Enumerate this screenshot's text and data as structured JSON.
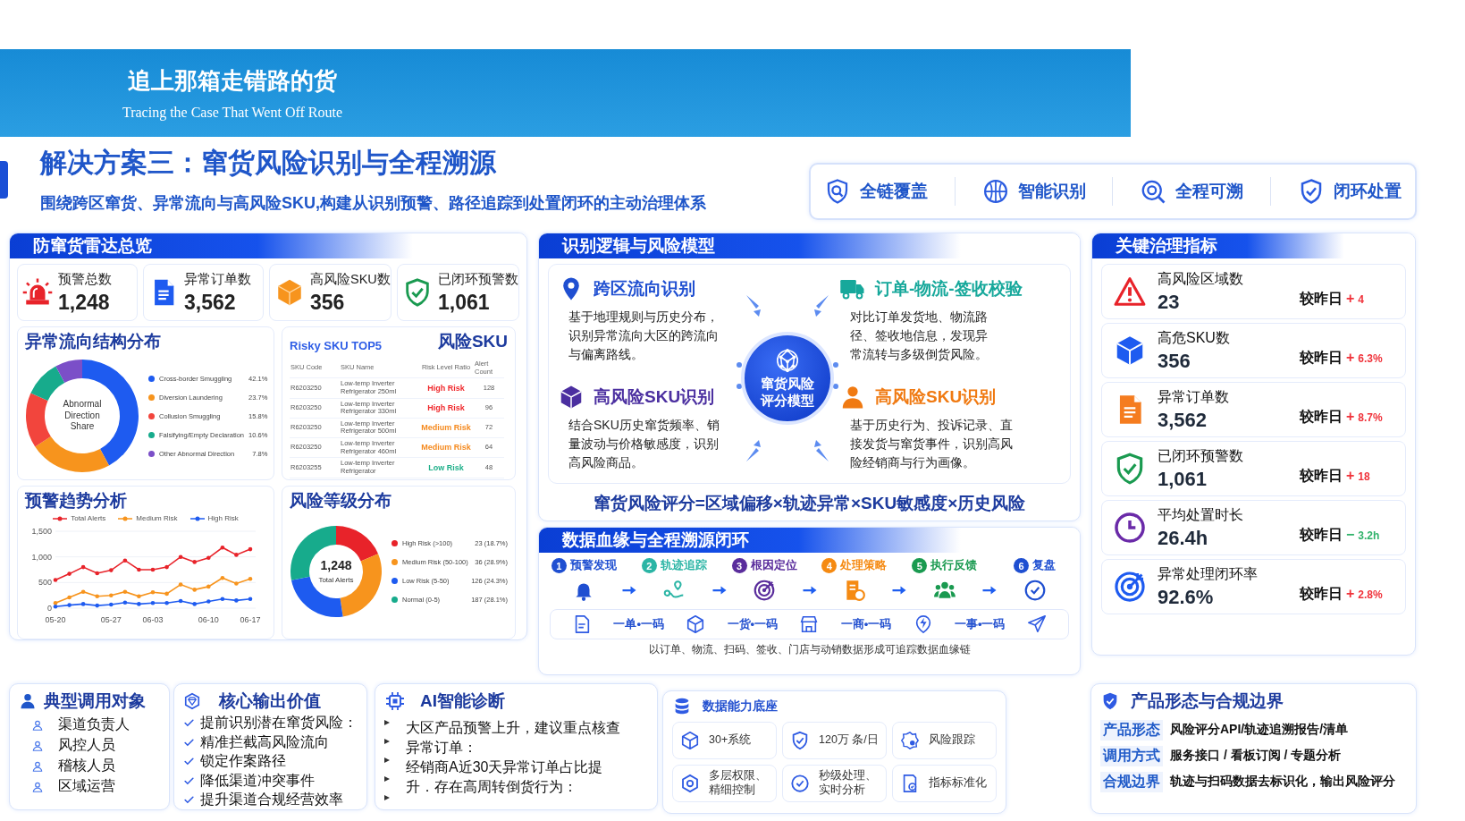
{
  "banner": {
    "title": "追上那箱走错路的货",
    "subtitle": "Tracing the Case That Went Off Route"
  },
  "heading": {
    "title": "解决方案三：窜货风险识别与全程溯源",
    "subtitle": "围绕跨区窜货、异常流向与高风险SKU,构建从识别预警、路径追踪到处置闭环的主动治理体系",
    "highlights": [
      "全链覆盖",
      "智能识别",
      "全程可溯",
      "闭环处置"
    ]
  },
  "radar": {
    "title": "防窜货雷达总览",
    "stats": [
      {
        "label": "预警总数",
        "value": "1,248"
      },
      {
        "label": "异常订单数",
        "value": "3,562"
      },
      {
        "label": "高风险SKU数",
        "value": "356"
      },
      {
        "label": "已闭环预警数",
        "value": "1,061"
      }
    ],
    "flow": {
      "title": "异常流向结构分布",
      "chart_data": {
        "type": "donut",
        "title": "Abnormal Direction Share",
        "categories": [
          "Cross-border Smuggling",
          "Diversion Laundering",
          "Collusion Smuggling",
          "Falsifying/Empty Declaration",
          "Other Abnormal Direction"
        ],
        "values": [
          42.1,
          23.7,
          15.8,
          10.6,
          7.8
        ],
        "colors": [
          "#1e5bf0",
          "#f7941d",
          "#f2453d",
          "#17ab8c",
          "#7b4fc8"
        ],
        "value_labels": [
          "42.1%",
          "23.7%",
          "15.8%",
          "10.6%",
          "7.8%"
        ]
      }
    },
    "sku": {
      "title": "风险SKU",
      "caption": "Risky SKU TOP5",
      "columns": [
        "SKU Code",
        "SKU Name",
        "Risk Level Ratio",
        "Alert Count"
      ],
      "rows": [
        {
          "code": "R6203250",
          "name": "Low-temp Inverter Refrigerator 250ml",
          "risk": "High Risk",
          "color": "#f0292c",
          "count": "128"
        },
        {
          "code": "R6203250",
          "name": "Low-temp Inverter Refrigerator 330ml",
          "risk": "High Risk",
          "color": "#f0292c",
          "count": "96"
        },
        {
          "code": "R6203250",
          "name": "Low-temp Inverter Refrigerator 500ml",
          "risk": "Medium Risk",
          "color": "#f58a1f",
          "count": "72"
        },
        {
          "code": "R6203250",
          "name": "Low-temp Inverter Refrigerator 460ml",
          "risk": "Medium Risk",
          "color": "#f58a1f",
          "count": "64"
        },
        {
          "code": "R6203255",
          "name": "Low-temp Inverter Refrigerator",
          "risk": "Low Risk",
          "color": "#20b08a",
          "count": "48"
        }
      ]
    },
    "trend": {
      "title": "预警趋势分析",
      "chart_data": {
        "type": "line",
        "categories": [
          "05-20",
          null,
          null,
          null,
          "05-27",
          null,
          null,
          "06-03",
          null,
          null,
          null,
          "06-10",
          null,
          null,
          "06-17"
        ],
        "ylim": [
          0,
          1500
        ],
        "yticks": [
          {
            "value": 0,
            "label": "0"
          },
          {
            "value": 500,
            "label": "500"
          },
          {
            "value": 1000,
            "label": "1,000"
          },
          {
            "value": 1500,
            "label": "1,500"
          }
        ],
        "series": [
          {
            "name": "Total Alerts",
            "color": "#e8232a",
            "values": [
              550,
              670,
              800,
              680,
              740,
              930,
              750,
              750,
              800,
              1000,
              900,
              980,
              1180,
              1040,
              1150
            ]
          },
          {
            "name": "Medium Risk",
            "color": "#f7941d",
            "values": [
              100,
              210,
              320,
              230,
              250,
              320,
              230,
              310,
              280,
              460,
              360,
              420,
              590,
              480,
              570
            ]
          },
          {
            "name": "High Risk",
            "color": "#1e5bf0",
            "values": [
              30,
              60,
              80,
              50,
              70,
              110,
              80,
              100,
              100,
              140,
              80,
              130,
              180,
              150,
              180
            ]
          }
        ]
      }
    },
    "risk": {
      "title": "风险等级分布",
      "center_value": "1,248",
      "center_label": "Total Alerts",
      "chart_data": {
        "type": "donut",
        "categories": [
          "High Risk (>100)",
          "Medium Risk (50-100)",
          "Low Risk (5-50)",
          "Normal (0-5)"
        ],
        "values": [
          18.7,
          28.9,
          24.3,
          28.1
        ],
        "colors": [
          "#e8232a",
          "#f7941d",
          "#1e5bf0",
          "#17ab8c"
        ],
        "value_labels": [
          "23 (18.7%)",
          "36 (28.9%)",
          "126 (24.3%)",
          "187 (28.1%)"
        ]
      }
    }
  },
  "model": {
    "title": "识别逻辑与风险模型",
    "hub": "窜货风险评分模型",
    "items": [
      {
        "title": "跨区流向识别",
        "text": "基于地理规则与历史分布，识别异常流向大区的跨流向与偏离路线。",
        "color": "#1f4fd1"
      },
      {
        "title": "订单-物流-签收校验",
        "text": "对比订单发货地、物流路径、签收地信息，发现异常流转与多级倒货风险。",
        "color": "#17a89b"
      },
      {
        "title": "高风险SKU识别",
        "text": "结合SKU历史窜货频率、销量波动与价格敏感度，识别高风险商品。",
        "color": "#4b2fa0"
      },
      {
        "title": "高风险SKU识别",
        "text": "基于历史行为、投诉记录、直接发货与窜货事件，识别高风险经销商与行为画像。",
        "color": "#f07a12"
      }
    ],
    "formula": "窜货风险评分=区域偏移×轨迹异常×SKU敏感度×历史风险"
  },
  "lineage": {
    "title": "数据血缘与全程溯源闭环",
    "steps": [
      {
        "num": "1",
        "label": "预警发现",
        "color": "#1f4fd1"
      },
      {
        "num": "2",
        "label": "轨迹追踪",
        "color": "#2bb5a5"
      },
      {
        "num": "3",
        "label": "根因定位",
        "color": "#5a2d9c"
      },
      {
        "num": "4",
        "label": "处理策略",
        "color": "#f58a12"
      },
      {
        "num": "5",
        "label": "执行反馈",
        "color": "#1a9a50"
      },
      {
        "num": "6",
        "label": "复盘",
        "color": "#1f4fd1"
      }
    ],
    "codes": [
      "一单•一码",
      "一货•一码",
      "一商•一码",
      "一事•一码"
    ],
    "caption": "以订单、物流、扫码、签收、门店与动销数据形成可追踪数据血缘链"
  },
  "metrics": {
    "title": "关键治理指标",
    "items": [
      {
        "label": "高风险区域数",
        "value": "23",
        "compare": "较昨日",
        "sign": "+",
        "delta": "4",
        "color": "#f0323a"
      },
      {
        "label": "高危SKU数",
        "value": "356",
        "compare": "较昨日",
        "sign": "+",
        "delta": "6.3%",
        "color": "#f0323a"
      },
      {
        "label": "异常订单数",
        "value": "3,562",
        "compare": "较昨日",
        "sign": "+",
        "delta": "8.7%",
        "color": "#f0323a"
      },
      {
        "label": "已闭环预警数",
        "value": "1,061",
        "compare": "较昨日",
        "sign": "+",
        "delta": "18",
        "color": "#f0323a"
      },
      {
        "label": "平均处置时长",
        "value": "26.4h",
        "compare": "较昨日",
        "sign": "−",
        "delta": "3.2h",
        "color": "#2fb26a"
      },
      {
        "label": "异常处理闭环率",
        "value": "92.6%",
        "compare": "较昨日",
        "sign": "+",
        "delta": "2.8%",
        "color": "#f0323a"
      }
    ]
  },
  "users": {
    "title": "典型调用对象",
    "items": [
      "渠道负责人",
      "风控人员",
      "稽核人员",
      "区域运营"
    ]
  },
  "values": {
    "title": "核心输出价值",
    "items": [
      "提前识别潜在窜货风险：",
      "精准拦截高风险流向",
      "锁定作案路径",
      "降低渠道冲突事件",
      "提升渠道合规经营效率"
    ]
  },
  "ai": {
    "title": "AI智能诊断",
    "paragraphs": [
      "大区产品预警上升，建议重点核查异常订单：",
      "经销商A近30天异常订单占比提升．存在高周转倒货行为："
    ]
  },
  "capability": {
    "title": "数据能力底座",
    "tiles": [
      {
        "lines": [
          "30+系统"
        ]
      },
      {
        "lines": [
          "120万 条/日"
        ]
      },
      {
        "lines": [
          "风险跟踪"
        ]
      },
      {
        "lines": [
          "多层权限、",
          "精细控制"
        ]
      },
      {
        "lines": [
          "秒级处理、",
          "实时分析"
        ]
      },
      {
        "lines": [
          "指标标准化"
        ]
      }
    ]
  },
  "product": {
    "title": "产品形态与合规边界",
    "rows": [
      {
        "label": "产品形态",
        "value": "风险评分API/轨迹追溯报告/清单"
      },
      {
        "label": "调用方式",
        "value": "服务接口 / 看板订阅 / 专题分析"
      },
      {
        "label": "合规边界",
        "value": "轨迹与扫码数据去标识化，输出风险评分"
      }
    ]
  }
}
